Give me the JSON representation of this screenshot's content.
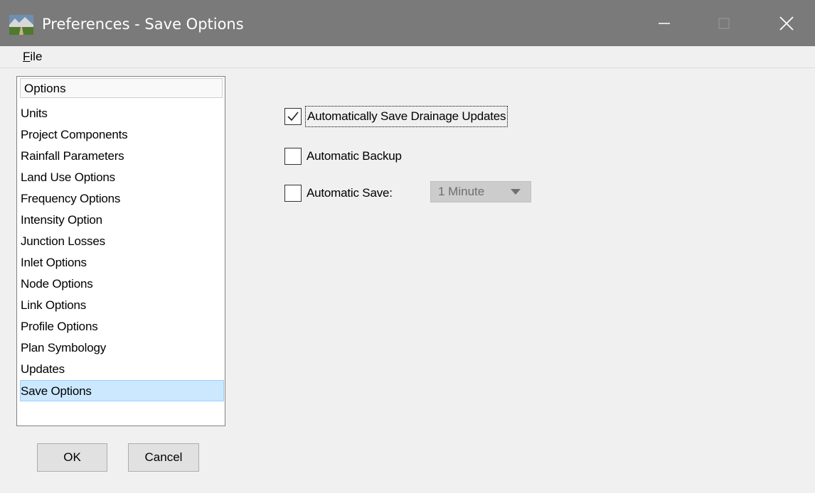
{
  "window": {
    "title": "Preferences - Save Options",
    "icon": "landscape-app-icon",
    "controls": [
      "minimize-icon",
      "maximize-icon",
      "close-icon"
    ]
  },
  "menu": {
    "file_accel": "F",
    "file_rest": "ile"
  },
  "options": {
    "header": "Options",
    "items": [
      "Units",
      "Project Components",
      "Rainfall Parameters",
      "Land Use Options",
      "Frequency Options",
      "Intensity Option",
      "Junction Losses",
      "Inlet Options",
      "Node Options",
      "Link Options",
      "Profile Options",
      "Plan Symbology",
      "Updates",
      "Save Options"
    ],
    "selected": "Save Options"
  },
  "buttons": {
    "ok": "OK",
    "cancel": "Cancel"
  },
  "save_options": {
    "auto_save_drainage": {
      "label": "Automatically Save Drainage Updates",
      "checked": true
    },
    "auto_backup": {
      "label": "Automatic Backup",
      "checked": false
    },
    "auto_save": {
      "label": "Automatic Save:",
      "checked": false,
      "interval": "1 Minute"
    }
  },
  "colors": {
    "titlebar": "#7a7a7a",
    "selection": "#cce8ff"
  }
}
